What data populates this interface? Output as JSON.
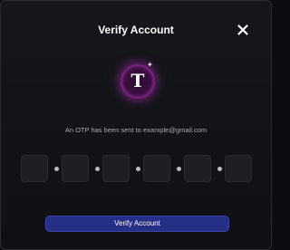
{
  "modal": {
    "title": "Verify Account",
    "close_icon": "close-icon",
    "logo": {
      "letter": "T",
      "sparkle_icon": "sparkle-icon"
    },
    "subtitle": "An OTP has been sent to example@gmail.com",
    "otp": {
      "digits": [
        "",
        "",
        "",
        "",
        "",
        ""
      ],
      "separator_icon": "dot-icon"
    },
    "primary_button_label": "Verify Account"
  },
  "colors": {
    "accent": "#262f86",
    "glow": "#a828b4"
  }
}
